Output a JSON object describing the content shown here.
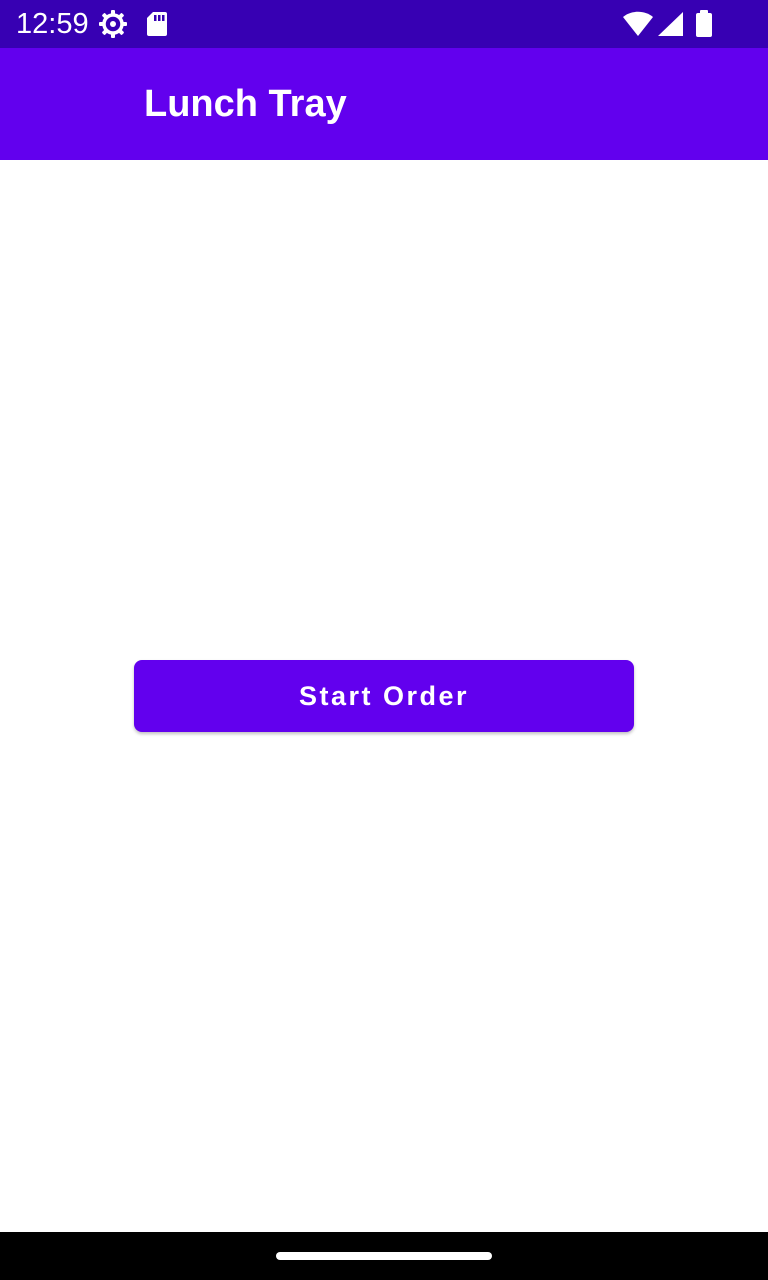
{
  "status_bar": {
    "time": "12:59",
    "background_color": "#3700b3",
    "left_icons": [
      "settings-gear-icon",
      "sd-card-icon"
    ],
    "right_icons": [
      "wifi-icon",
      "cell-signal-icon",
      "battery-icon"
    ]
  },
  "app_bar": {
    "title": "Lunch Tray",
    "background_color": "#6200ee"
  },
  "main": {
    "start_button_label": "Start Order",
    "button_color": "#6200ee"
  },
  "nav_bar": {
    "background_color": "#000000",
    "handle": "home-gesture-handle"
  }
}
